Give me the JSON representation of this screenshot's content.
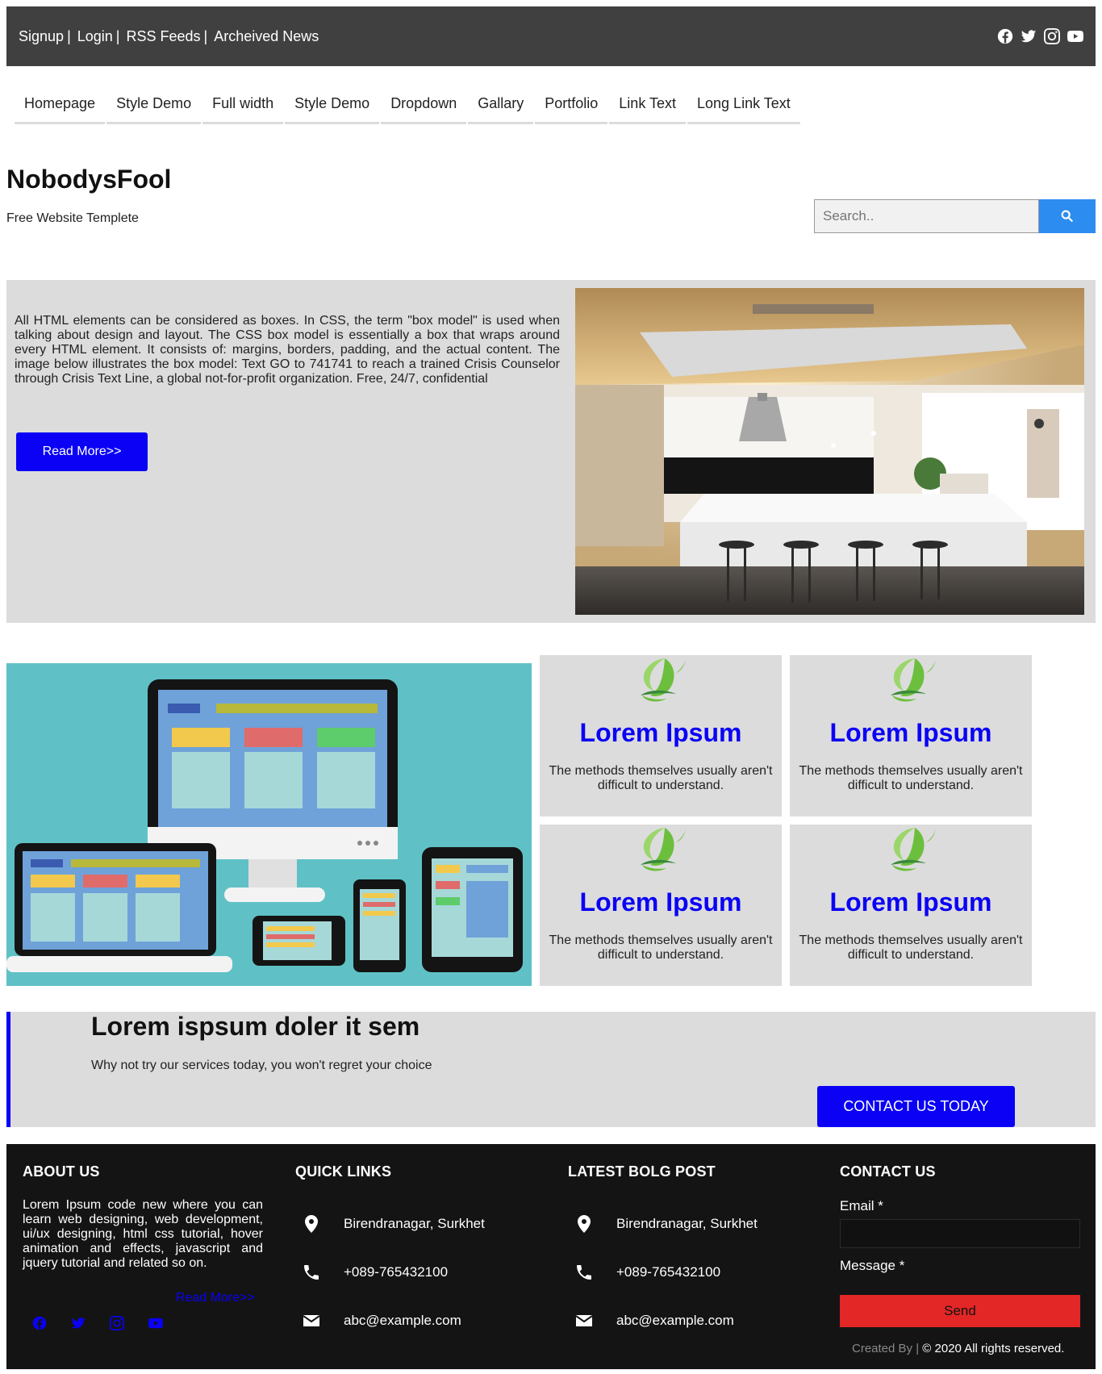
{
  "topbar": {
    "links": [
      "Signup",
      "Login",
      "RSS Feeds",
      "Archeived News"
    ],
    "separator": "|",
    "social_icons": [
      "facebook-icon",
      "twitter-icon",
      "instagram-icon",
      "youtube-icon"
    ]
  },
  "nav": {
    "items": [
      "Homepage",
      "Style Demo",
      "Full width",
      "Style Demo",
      "Dropdown",
      "Gallary",
      "Portfolio",
      "Link Text",
      "Long Link Text"
    ]
  },
  "brand": {
    "title": "NobodysFool",
    "subtitle": "Free Website Templete"
  },
  "search": {
    "placeholder": "Search..",
    "icon": "search-icon"
  },
  "hero": {
    "text": "All HTML elements can be considered as boxes. In CSS, the term \"box model\" is used when talking about design and layout. The CSS box model is essentially a box that wraps around every HTML element. It consists of: margins, borders, padding, and the actual content. The image below illustrates the box model: Text GO to 741741 to reach a trained Crisis Counselor through Crisis Text Line, a global not-for-profit organization. Free, 24/7, confidential",
    "button": "Read More>>",
    "button_color": "#0a01f5"
  },
  "features": {
    "cards": [
      {
        "title": "Lorem Ipsum",
        "text": "The methods themselves usually aren't difficult to understand."
      },
      {
        "title": "Lorem Ipsum",
        "text": "The methods themselves usually aren't difficult to understand."
      },
      {
        "title": "Lorem Ipsum",
        "text": "The methods themselves usually aren't difficult to understand."
      },
      {
        "title": "Lorem Ipsum",
        "text": "The methods themselves usually aren't difficult to understand."
      }
    ],
    "title_color": "#0a01f5"
  },
  "cta": {
    "heading": "Lorem ispsum doler it sem",
    "text": "Why not try our services today, you won't regret your choice",
    "button": "CONTACT US TODAY"
  },
  "footer": {
    "about": {
      "heading": "ABOUT US",
      "text": "Lorem Ipsum code new where you can learn web designing, web development, ui/ux designing, html css tutorial, hover animation and effects, javascript and jquery tutorial and related so on.",
      "read_more": "Read More>>",
      "social_icons": [
        "facebook-icon",
        "twitter-icon",
        "instagram-icon",
        "youtube-icon"
      ]
    },
    "quick_links": {
      "heading": "QUICK LINKS",
      "items": [
        "Birendranagar, Surkhet",
        "+089-765432100",
        "abc@example.com"
      ]
    },
    "latest_blog": {
      "heading": "LATEST BOLG POST",
      "items": [
        "Birendranagar, Surkhet",
        "+089-765432100",
        "abc@example.com"
      ]
    },
    "contact": {
      "heading": "CONTACT US",
      "email_label": "Email *",
      "message_label": "Message *",
      "send": "Send",
      "send_color": "#e32626"
    },
    "credit_prefix": "Created By |",
    "credit_suffix": "2020 All rights reserved."
  }
}
